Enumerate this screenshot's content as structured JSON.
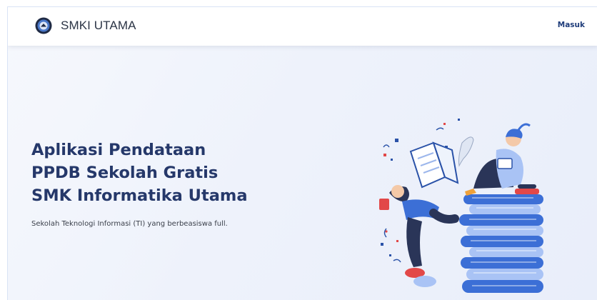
{
  "header": {
    "brand": "SMKI UTAMA",
    "login_label": "Masuk",
    "logo_icon": "school-emblem-icon"
  },
  "hero": {
    "title_lines": [
      "Aplikasi Pendataan",
      "PPDB Sekolah Gratis",
      "SMK Informatika Utama"
    ],
    "subtitle": "Sekolah Teknologi Informasi (TI) yang berbeasiswa full.",
    "illustration": "students-reading-on-book-stack-illustration"
  },
  "colors": {
    "accent": "#1e3c7a",
    "title": "#25386a",
    "book_blue": "#3c6fd6",
    "book_light": "#a9c3f5",
    "background": "#eef2fb"
  }
}
